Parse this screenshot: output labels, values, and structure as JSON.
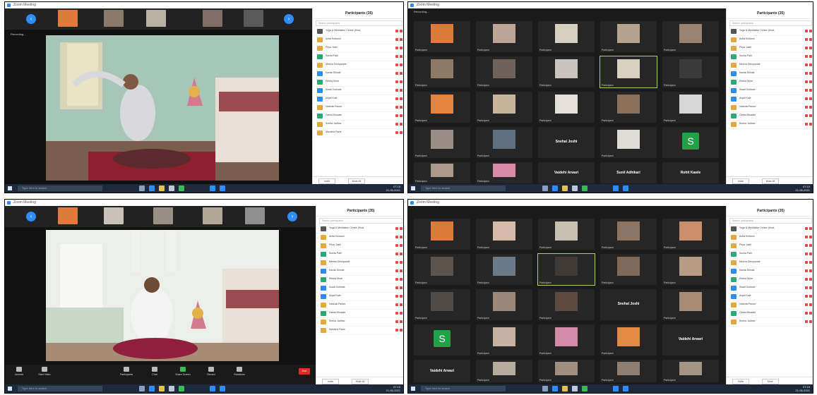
{
  "window_title": "Zoom Meeting",
  "stage_label": "Recording...",
  "panel": {
    "title": "Participants (35)",
    "search_placeholder": "Search participants",
    "invite_label": "Invite",
    "mute_all_label": "Mute All",
    "more_label": "More"
  },
  "participants": [
    "Yoga & Meditation Centre (Host, me)",
    "Anita Kulkarni",
    "Priya Joshi",
    "Sunita Patil",
    "Meena Deshpande",
    "Kavita Shinde",
    "Rekha More",
    "Swati Gokhale",
    "Anjali Kale",
    "Vaishali Pawar",
    "Geeta Bhosale",
    "Sneha Jadhav",
    "Manisha Rane"
  ],
  "grid_names": {
    "text_tile_1": "Snehal Joshi",
    "text_tile_2": "Vaidehi Arwari",
    "text_tile_3": "Sunil Adhikari",
    "text_tile_4": "Rohit Kawle",
    "text_tile_5": "Vaidehi Arwari",
    "text_tile_6": "Vaidehi Arwari"
  },
  "tile_caption": "Participant",
  "letter_avatar": "S",
  "toolbar": {
    "mute": "Unmute",
    "video": "Start Video",
    "participants": "Participants",
    "chat": "Chat",
    "share": "Share Screen",
    "record": "Record",
    "reactions": "Reactions",
    "end": "End"
  },
  "taskbar": {
    "search_placeholder": "Type here to search",
    "time": "07:15",
    "date": "21-06-2021"
  },
  "colors": {
    "zoom_blue": "#2d8cff",
    "panel_bg": "#ffffff",
    "stage_bg": "#1b1b1b",
    "end_red": "#d93025",
    "speaker_outline": "#a8d26a",
    "avatar_green": "#24a148"
  }
}
